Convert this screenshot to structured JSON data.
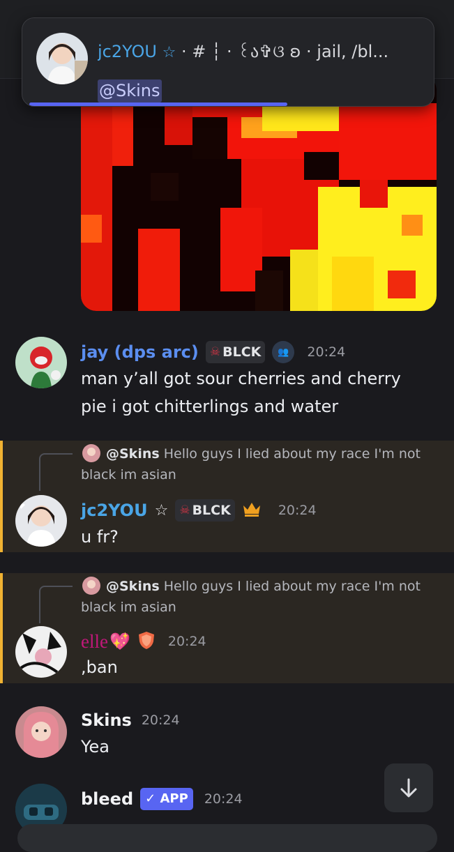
{
  "notification": {
    "author": "jc2YOU",
    "star": "☆",
    "channel": " · # ┆ · ꒰ა✞ଓ ʚ · jail, /bl...",
    "mention": "@Skins"
  },
  "messages": [
    {
      "username": "jay (dps arc)",
      "tag": "BLCK",
      "time": "20:24",
      "text": "man y’all got sour cherries and cherry pie i got chitterlings and water",
      "name_color": "#5b8ef0"
    },
    {
      "reply_user": "@Skins",
      "reply_text": "Hello guys I lied about my race I'm not black im asian",
      "username": "jc2YOU",
      "star": "☆",
      "tag": "BLCK",
      "time": "20:24",
      "text": "u fr?",
      "name_color": "#4aa5e6"
    },
    {
      "reply_user": "@Skins",
      "reply_text": "Hello guys I lied about my race I'm not black im asian",
      "username": "elle",
      "emoji": "💖",
      "time": "20:24",
      "text": ",ban",
      "name_color": "#c2187a"
    },
    {
      "username": "Skins",
      "time": "20:24",
      "text": "Yea",
      "name_color": "#f2f3f5"
    },
    {
      "username": "bleed",
      "badge": "✓ APP",
      "time": "20:24",
      "name_color": "#f2f3f5"
    }
  ],
  "colors": {
    "background": "#1a1a1e",
    "highlight": "#2b2722",
    "highlight_bar": "#f0b232",
    "accent": "#5865f2",
    "mention_bg": "#3d4170"
  },
  "icons": [
    "star-icon",
    "skull-icon",
    "crown-icon",
    "shield-icon",
    "checkmark-icon",
    "arrow-down-icon",
    "people-icon"
  ]
}
